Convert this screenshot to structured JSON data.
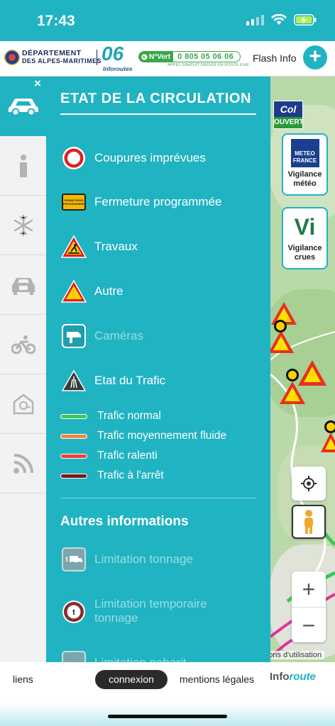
{
  "status": {
    "time": "17:43"
  },
  "header": {
    "dept_line1": "DÉPARTEMENT",
    "dept_line2": "DES ALPES-MARITIMES",
    "logo06": "06",
    "logo06_sub": "Inforoutes",
    "novert_tag": "N°Vert",
    "novert_number": "0 805 05 06 06",
    "novert_sub": "APPEL GRATUIT DEPUIS UN POSTE FIXE",
    "flash_info": "Flash Info",
    "plus": "+"
  },
  "rail": {
    "close": "×",
    "items": [
      {
        "icon": "car-icon",
        "active": true
      },
      {
        "icon": "info-icon"
      },
      {
        "icon": "snowflake-icon"
      },
      {
        "icon": "carpool-icon"
      },
      {
        "icon": "bicycle-icon"
      },
      {
        "icon": "email-icon"
      },
      {
        "icon": "rss-icon"
      }
    ]
  },
  "panel": {
    "title": "ETAT DE LA CIRCULATION",
    "legend": [
      {
        "label": "Coupures imprévues",
        "icon": "road-closed-icon"
      },
      {
        "label": "Fermeture programmée",
        "icon": "scheduled-closure-icon",
        "sign_text": "FERMETURES PROGRAMMEES"
      },
      {
        "label": "Travaux",
        "icon": "roadworks-icon"
      },
      {
        "label": "Autre",
        "icon": "warning-icon"
      },
      {
        "label": "Caméras",
        "icon": "camera-icon"
      },
      {
        "label": "Etat du Trafic",
        "icon": "traffic-state-icon"
      }
    ],
    "traffic": [
      {
        "label": "Trafic normal",
        "color": "#3cc85a"
      },
      {
        "label": "Trafic moyennement fluide",
        "color": "#f0883a"
      },
      {
        "label": "Trafic ralenti",
        "color": "#e8443a"
      },
      {
        "label": "Trafic à l'arrêt",
        "color": "#7a1a1a"
      }
    ],
    "other_title": "Autres informations",
    "other": [
      {
        "label": "Limitation tonnage",
        "icon": "tonnage-icon",
        "sign_text": "t"
      },
      {
        "label": "Limitation temporaire tonnage",
        "icon": "temporary-tonnage-icon",
        "sign_text": "t"
      },
      {
        "label": "Limitation gabarit",
        "icon": "gauge-icon"
      }
    ]
  },
  "map": {
    "col_top": "Col",
    "col_bottom": "OUVERT",
    "meteo_logo1": "METEO",
    "meteo_logo2": "FRANCE",
    "meteo_label": "Vigilance météo",
    "crues_label": "Vigilance crues",
    "crues_logo": "Vi",
    "conditions": "Conditions d'utilisation"
  },
  "bottom": {
    "liens": "liens",
    "connexion": "connexion",
    "mentions": "mentions légales",
    "logo_a": "Info",
    "logo_b": "route"
  },
  "colors": {
    "teal": "#20b3c2",
    "rail_bg": "#f2f2f2"
  }
}
